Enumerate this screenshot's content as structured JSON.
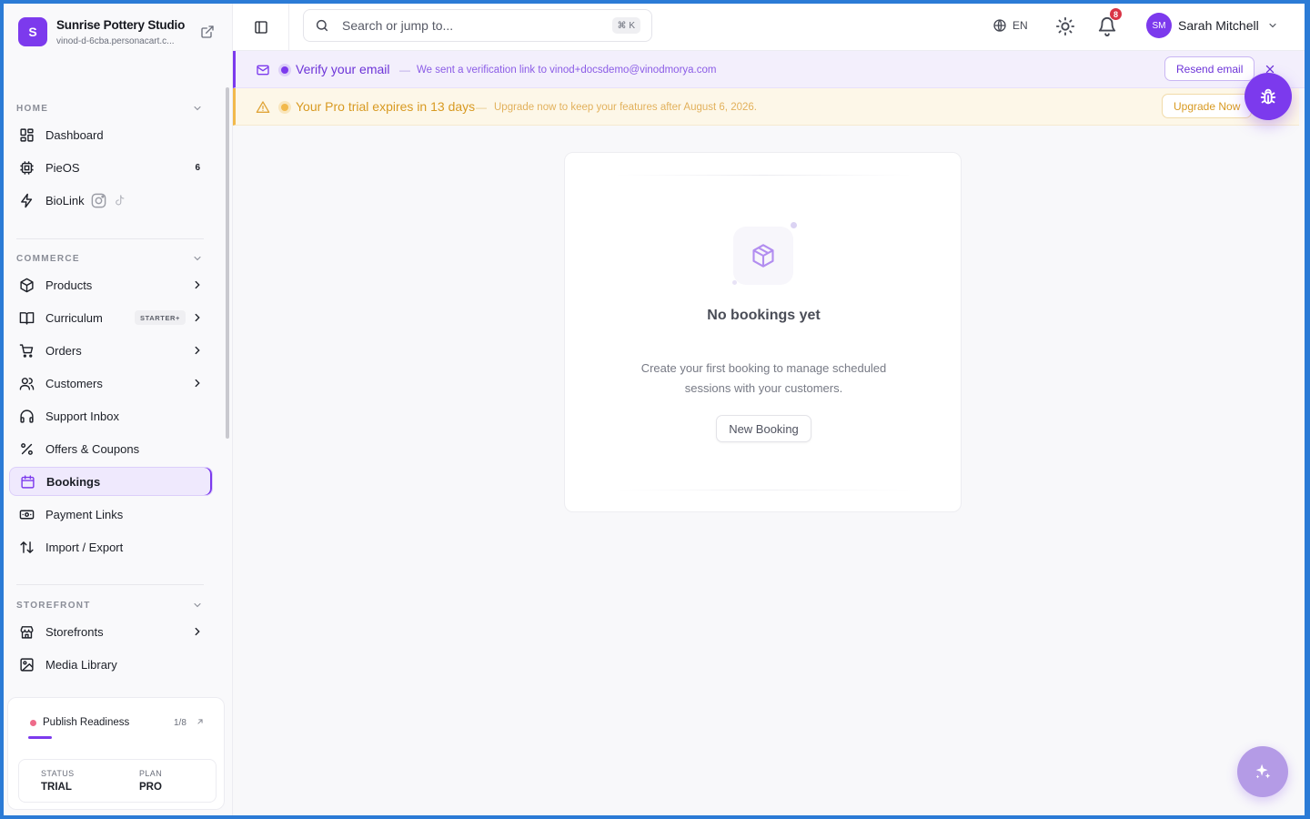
{
  "brand": {
    "initial": "S",
    "name": "Sunrise Pottery Studio",
    "url": "vinod-d-6cba.personacart.c..."
  },
  "sidebar": {
    "sections": {
      "home": "HOME",
      "commerce": "COMMERCE",
      "storefront": "STOREFRONT"
    },
    "home_items": [
      {
        "label": "Dashboard",
        "icon": "grid-icon"
      },
      {
        "label": "PieOS",
        "icon": "cpu-icon",
        "count": "6"
      },
      {
        "label": "BioLink",
        "icon": "bolt-icon"
      }
    ],
    "commerce_items": [
      {
        "label": "Products",
        "icon": "box-icon"
      },
      {
        "label": "Curriculum",
        "icon": "book-icon",
        "badge": "STARTER+"
      },
      {
        "label": "Orders",
        "icon": "cart-icon"
      },
      {
        "label": "Customers",
        "icon": "users-icon"
      },
      {
        "label": "Support Inbox",
        "icon": "headphones-icon"
      },
      {
        "label": "Offers & Coupons",
        "icon": "percent-icon"
      },
      {
        "label": "Bookings",
        "icon": "calendar-icon",
        "active": true
      },
      {
        "label": "Payment Links",
        "icon": "banknote-icon"
      },
      {
        "label": "Import / Export",
        "icon": "arrows-updown-icon"
      }
    ],
    "storefront_items": [
      {
        "label": "Storefronts",
        "icon": "store-icon"
      },
      {
        "label": "Media Library",
        "icon": "image-icon"
      }
    ],
    "publish": {
      "label": "Publish Readiness",
      "count": "1/8",
      "progress": 0.125,
      "status_key": "STATUS",
      "status_value": "TRIAL",
      "plan_key": "PLAN",
      "plan_value": "PRO"
    }
  },
  "topbar": {
    "search_placeholder": "Search or jump to...",
    "shortcut": "⌘ K",
    "language": "EN",
    "notifications": "8",
    "user_initials": "SM",
    "user_name": "Sarah Mitchell"
  },
  "banners": {
    "email": {
      "title": "Verify your email",
      "separator": "—",
      "message": "We sent a verification link to vinod+docsdemo@vinodmorya.com",
      "button": "Resend email"
    },
    "trial": {
      "title": "Your Pro trial expires in 13 days",
      "separator": "—",
      "message": "Upgrade now to keep your features after August 6, 2026.",
      "button": "Upgrade Now"
    }
  },
  "empty_state": {
    "title": "No bookings yet",
    "description": "Create your first booking to manage scheduled sessions with your customers.",
    "button": "New Booking"
  },
  "colors": {
    "accent": "#7c3aed",
    "warning": "#f2b94b",
    "danger": "#d93445"
  }
}
